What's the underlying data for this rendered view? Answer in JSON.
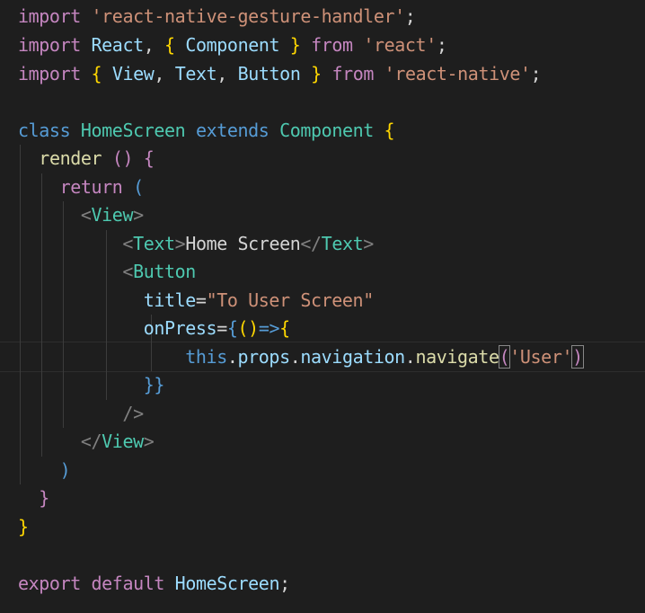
{
  "code": {
    "line1": {
      "kw": "import",
      "str": "'react-native-gesture-handler'",
      "semi": ";"
    },
    "line2": {
      "kw": "import",
      "default": "React",
      "comma": ",",
      "open": "{",
      "named": "Component",
      "close": "}",
      "from": "from",
      "str": "'react'",
      "semi": ";"
    },
    "line3": {
      "kw": "import",
      "open": "{",
      "n1": "View",
      "c1": ",",
      "n2": "Text",
      "c2": ",",
      "n3": "Button",
      "close": "}",
      "from": "from",
      "str": "'react-native'",
      "semi": ";"
    },
    "line5": {
      "kw": "class",
      "name": "HomeScreen",
      "ext": "extends",
      "base": "Component",
      "brace": "{"
    },
    "line6": {
      "fn": "render",
      "parens": "()",
      "brace": "{"
    },
    "line7": {
      "kw": "return",
      "paren": "("
    },
    "line8": {
      "lt": "<",
      "tag": "View",
      "gt": ">"
    },
    "line9": {
      "lt": "<",
      "tag": "Text",
      "gt": ">",
      "text": "Home Screen",
      "clt": "</",
      "ctag": "Text",
      "cgt": ">"
    },
    "line10": {
      "lt": "<",
      "tag": "Button"
    },
    "line11": {
      "attr": "title",
      "eq": "=",
      "str": "\"To User Screen\""
    },
    "line12": {
      "attr": "onPress",
      "eq": "=",
      "brace": "{",
      "parens": "()",
      "arrow": "=>",
      "brace2": "{"
    },
    "line13": {
      "this": "this",
      "dot1": ".",
      "props": "props",
      "dot2": ".",
      "navigation": "navigation",
      "dot3": ".",
      "navigate": "navigate",
      "open": "(",
      "str": "'User'",
      "close": ")"
    },
    "line14": {
      "close": "}}"
    },
    "line15": {
      "selfclose": "/>"
    },
    "line16": {
      "clt": "</",
      "tag": "View",
      "gt": ">"
    },
    "line17": {
      "paren": ")"
    },
    "line18": {
      "brace": "}"
    },
    "line19": {
      "brace": "}"
    },
    "line21": {
      "kw": "export",
      "def": "default",
      "name": "HomeScreen",
      "semi": ";"
    }
  }
}
